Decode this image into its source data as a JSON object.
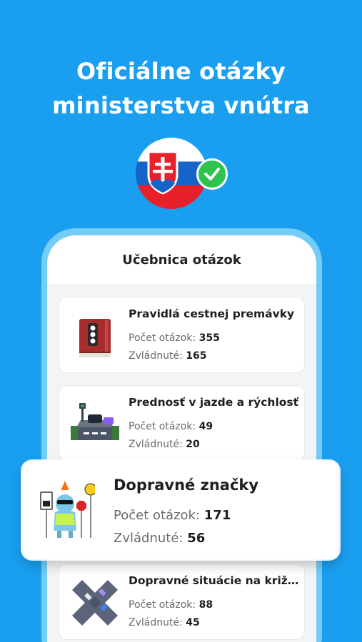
{
  "headline": {
    "line1": "Oficiálne otázky",
    "line2": "ministerstva vnútra"
  },
  "colors": {
    "background": "#1a9ff0",
    "check": "#2fc24f",
    "flag_white": "#ffffff",
    "flag_blue": "#1565c9",
    "flag_red": "#e8202a"
  },
  "screen": {
    "title": "Učebnica otázok"
  },
  "categories": [
    {
      "title": "Pravidlá cestnej premávky",
      "count_label": "Počet otázok:",
      "count": "355",
      "mastered_label": "Zvládnuté:",
      "mastered": "165",
      "icon": "rulebook-icon"
    },
    {
      "title": "Prednosť v jazde a rýchlosť",
      "count_label": "Počet otázok:",
      "count": "49",
      "mastered_label": "Zvládnuté:",
      "mastered": "20",
      "icon": "crossing-road-icon"
    },
    {
      "title": "Dopravné značky",
      "count_label": "Počet otázok:",
      "count": "171",
      "mastered_label": "Zvládnuté:",
      "mastered": "56",
      "icon": "traffic-signs-mascot-icon"
    },
    {
      "title": "Dopravné situácie na križo...",
      "count_label": "Počet otázok:",
      "count": "88",
      "mastered_label": "Zvládnuté:",
      "mastered": "45",
      "icon": "intersection-icon"
    }
  ]
}
